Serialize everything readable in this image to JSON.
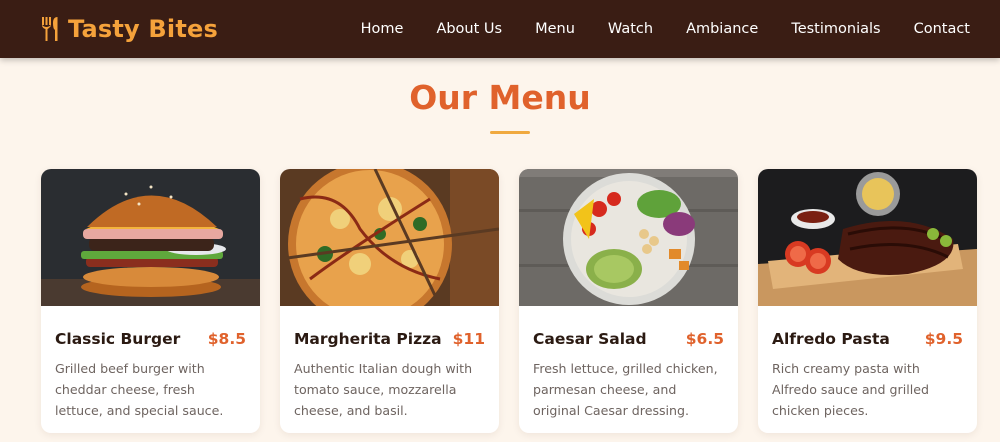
{
  "brand": {
    "name": "Tasty Bites",
    "icon": "utensils-icon",
    "color": "#f5a23b"
  },
  "nav": {
    "links": [
      "Home",
      "About Us",
      "Menu",
      "Watch",
      "Ambiance",
      "Testimonials",
      "Contact"
    ]
  },
  "menu_section": {
    "title": "Our Menu",
    "accent": "#e0622c",
    "items": [
      {
        "name": "Classic Burger",
        "price": "$8.5",
        "description": "Grilled beef burger with cheddar cheese, fresh lettuce, and special sauce.",
        "image": "burger-photo"
      },
      {
        "name": "Margherita Pizza",
        "price": "$11",
        "description": "Authentic Italian dough with tomato sauce, mozzarella cheese, and basil.",
        "image": "pizza-photo"
      },
      {
        "name": "Caesar Salad",
        "price": "$6.5",
        "description": "Fresh lettuce, grilled chicken, parmesan cheese, and original Caesar dressing.",
        "image": "salad-photo"
      },
      {
        "name": "Alfredo Pasta",
        "price": "$9.5",
        "description": "Rich creamy pasta with Alfredo sauce and grilled chicken pieces.",
        "image": "ribs-photo"
      }
    ]
  }
}
